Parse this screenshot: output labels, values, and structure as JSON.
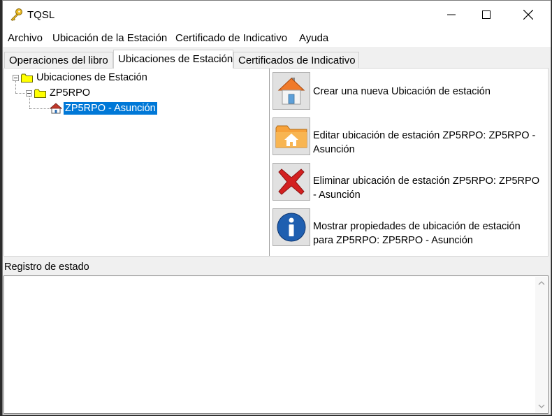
{
  "window": {
    "title": "TQSL"
  },
  "menu": [
    "Archivo",
    "Ubicación de la Estación",
    "Certificado de Indicativo",
    "Ayuda"
  ],
  "tabs": [
    "Operaciones del libro",
    "Ubicaciones de Estación",
    "Certificados de Indicativo"
  ],
  "active_tab": "Ubicaciones de Estación",
  "tree": {
    "root": "Ubicaciones de Estación",
    "callsign": "ZP5RPO",
    "location": "ZP5RPO - Asunción"
  },
  "actions": [
    {
      "icon": "house-icon",
      "lines": [
        "Crear una nueva Ubicación de estación"
      ]
    },
    {
      "icon": "folder-house-icon",
      "lines": [
        "Editar ubicación de estación ZP5RPO: ZP5RPO -",
        "Asunción"
      ]
    },
    {
      "icon": "red-x-icon",
      "lines": [
        "Eliminar ubicación de estación ZP5RPO: ZP5RPO",
        "- Asunción"
      ]
    },
    {
      "icon": "info-icon",
      "lines": [
        "Mostrar propiedades de ubicación de estación",
        "para ZP5RPO: ZP5RPO - Asunción"
      ]
    }
  ],
  "status": {
    "label": "Registro de estado",
    "text": ""
  },
  "colors": {
    "selection": "#0078d7",
    "folder": "#ffff00"
  }
}
